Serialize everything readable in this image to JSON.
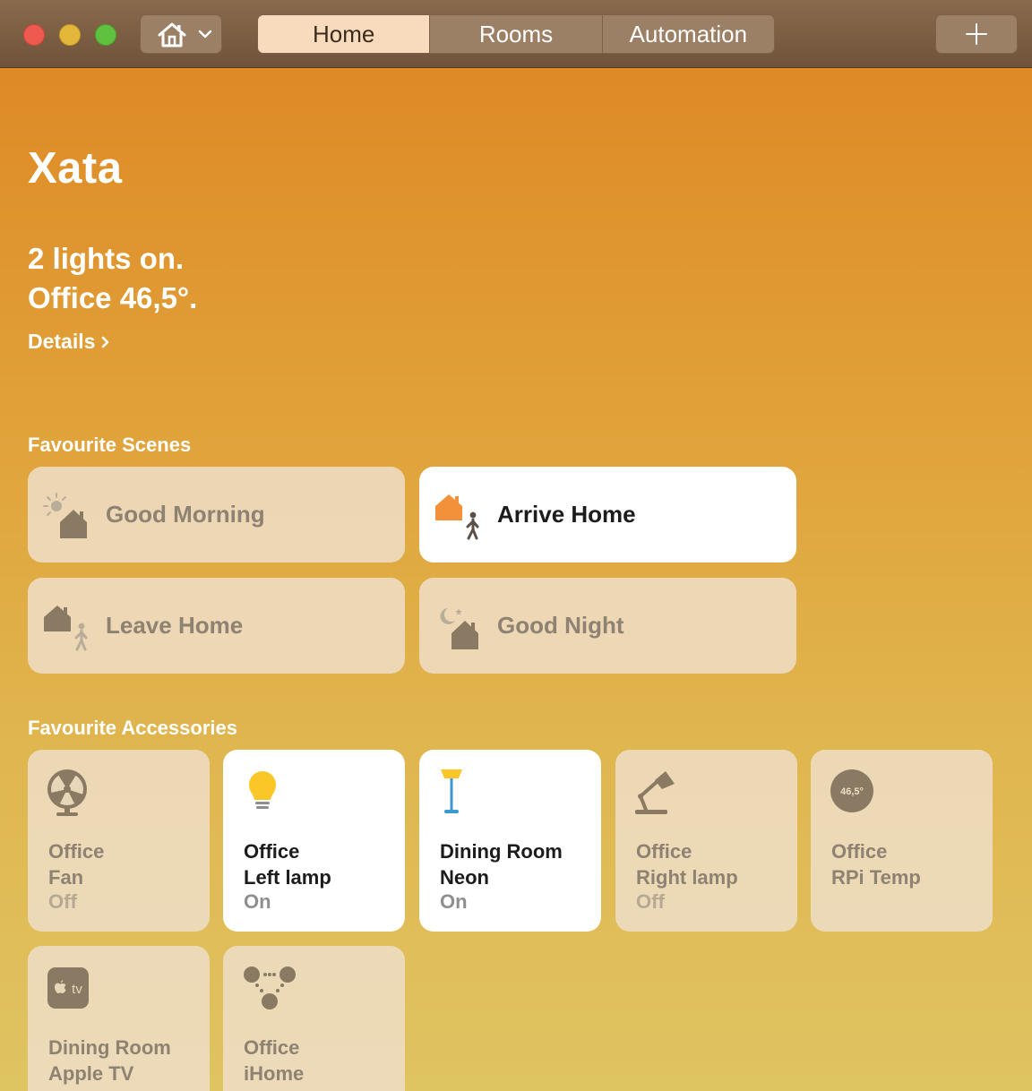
{
  "toolbar": {
    "tabs": [
      {
        "label": "Home",
        "active": true
      },
      {
        "label": "Rooms",
        "active": false
      },
      {
        "label": "Automation",
        "active": false
      }
    ],
    "home_menu_icon": "house-icon",
    "add_icon": "plus-icon"
  },
  "home": {
    "name": "Xata",
    "status_line_1": "2 lights on.",
    "status_line_2": "Office 46,5°.",
    "details_label": "Details"
  },
  "scenes": {
    "section_label": "Favourite Scenes",
    "items": [
      {
        "label": "Good Morning",
        "icon": "sunrise-house-icon",
        "active": false
      },
      {
        "label": "Arrive Home",
        "icon": "arrive-home-icon",
        "active": true
      },
      {
        "label": "Leave Home",
        "icon": "leave-home-icon",
        "active": false
      },
      {
        "label": "Good Night",
        "icon": "moon-house-icon",
        "active": false
      }
    ]
  },
  "accessories": {
    "section_label": "Favourite Accessories",
    "items": [
      {
        "room": "Office",
        "name": "Fan",
        "state": "Off",
        "icon": "fan-icon"
      },
      {
        "room": "Office",
        "name": "Left lamp",
        "state": "On",
        "icon": "lightbulb-icon"
      },
      {
        "room": "Dining Room",
        "name": "Neon",
        "state": "On",
        "icon": "floor-lamp-icon"
      },
      {
        "room": "Office",
        "name": "Right lamp",
        "state": "Off",
        "icon": "desk-lamp-icon"
      },
      {
        "room": "Office",
        "name": "RPi Temp",
        "state": "",
        "icon": "temperature-sensor-icon",
        "reading": "46,5°"
      },
      {
        "room": "Dining Room",
        "name": "Apple TV",
        "state": "",
        "icon": "apple-tv-icon",
        "badge": "tv"
      },
      {
        "room": "Office",
        "name": "iHome",
        "state": "",
        "icon": "bridge-icon"
      }
    ]
  },
  "colors": {
    "accent_orange": "#de8a26",
    "tile_off": "#eeddc4",
    "tile_on": "#ffffff",
    "titlebar": "#7a5c42"
  }
}
